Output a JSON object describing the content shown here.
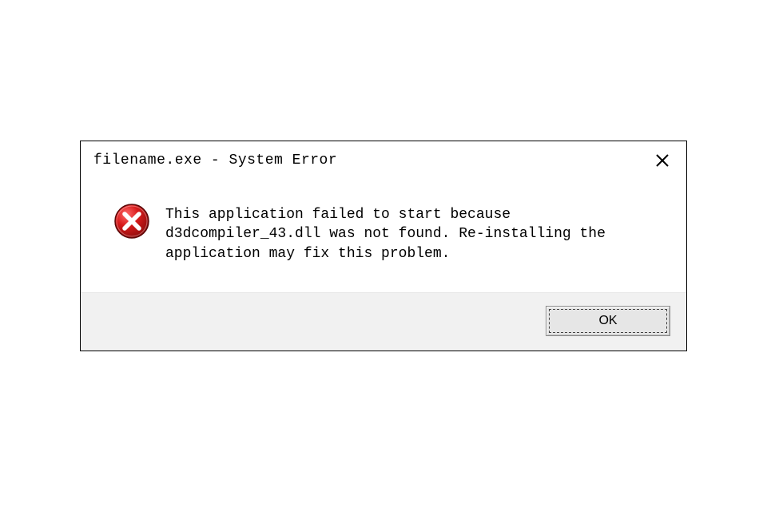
{
  "dialog": {
    "title": "filename.exe - System Error",
    "message": "This application failed to start because d3dcompiler_43.dll was not found. Re-installing the application may fix this problem.",
    "ok_label": "OK"
  }
}
